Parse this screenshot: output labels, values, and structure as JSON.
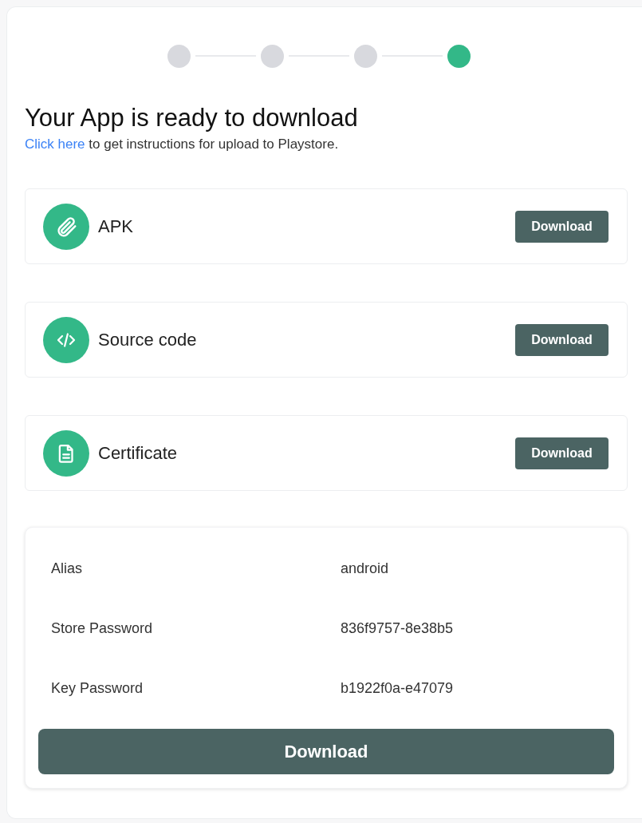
{
  "steps": [
    {
      "active": false
    },
    {
      "active": false
    },
    {
      "active": false
    },
    {
      "active": true
    }
  ],
  "heading": "Your App is ready to download",
  "instructions": {
    "link": "Click here",
    "text": "to get instructions for upload to Playstore."
  },
  "downloads": [
    {
      "kind": "attachment",
      "label": "APK",
      "button": "Download"
    },
    {
      "kind": "code",
      "label": "Source code",
      "button": "Download"
    },
    {
      "kind": "document",
      "label": "Certificate",
      "button": "Download"
    }
  ],
  "credentials": [
    {
      "label": "Alias",
      "value": "android"
    },
    {
      "label": "Store Password",
      "value": "836f9757-8e38b5"
    },
    {
      "label": "Key Password",
      "value": "b1922f0a-e47079"
    }
  ],
  "download_button": "Download"
}
